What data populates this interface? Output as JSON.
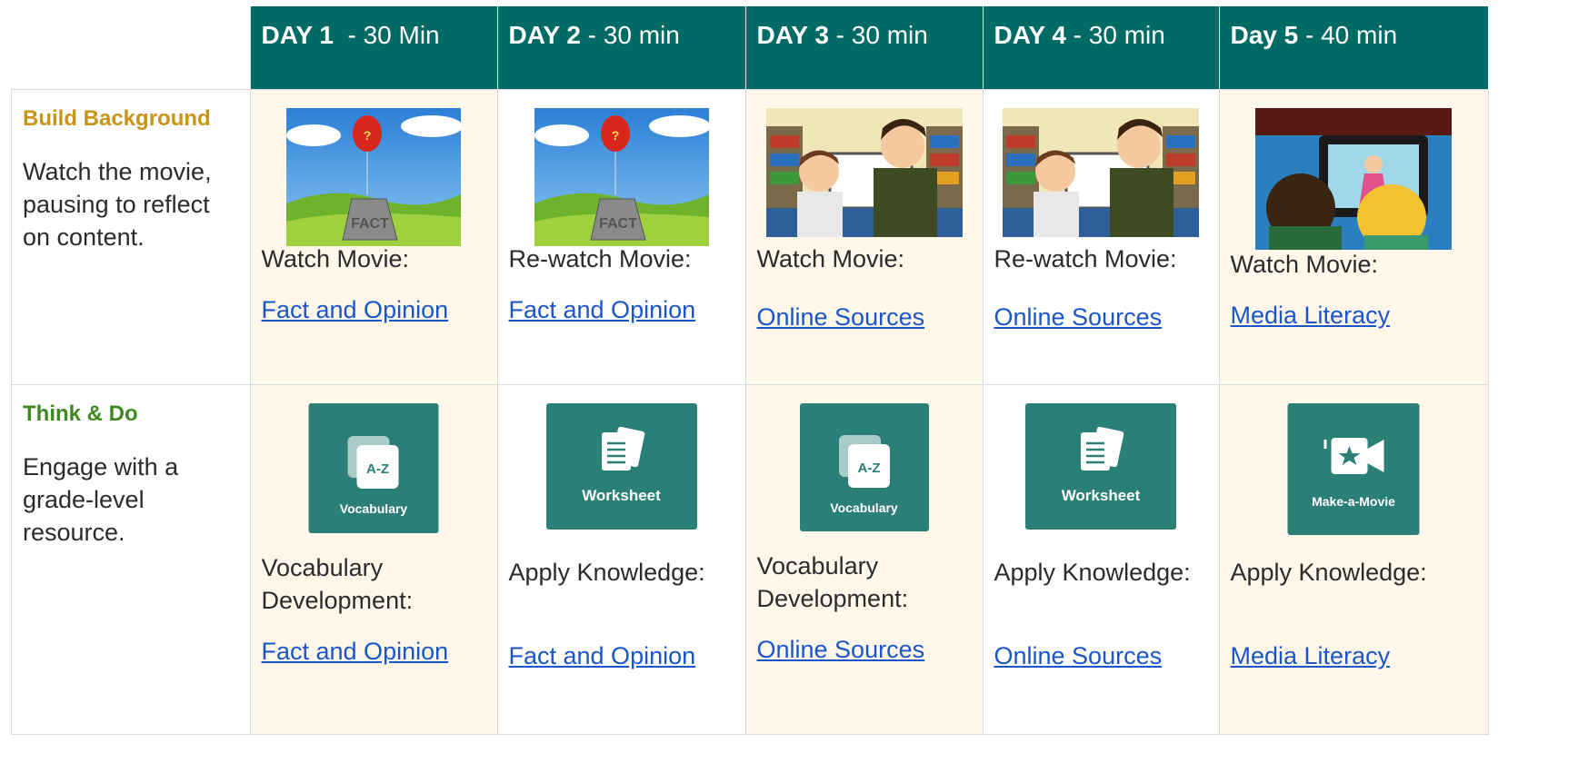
{
  "days": [
    {
      "label": "DAY 1",
      "duration": "  - 30 Min"
    },
    {
      "label": "DAY 2",
      "duration": " - 30 min"
    },
    {
      "label": "DAY 3",
      "duration": " - 30 min"
    },
    {
      "label": "DAY 4",
      "duration": " - 30 min"
    },
    {
      "label": "Day 5",
      "duration": " - 40 min"
    }
  ],
  "rows": {
    "build": {
      "title": "Build Background",
      "description": "Watch the movie, pausing to reflect on content.",
      "cells": [
        {
          "action": "Watch Movie:",
          "link": "Fact and Opinion",
          "thumb": "fact-opinion-balloon"
        },
        {
          "action": "Re-watch Movie:",
          "link": "Fact and Opinion",
          "thumb": "fact-opinion-balloon"
        },
        {
          "action": "Watch Movie:",
          "link": "Online Sources",
          "thumb": "library-computer"
        },
        {
          "action": "Re-watch Movie:",
          "link": "Online Sources",
          "thumb": "library-computer"
        },
        {
          "action": "Watch Movie:",
          "link": "Media Literacy",
          "thumb": "kids-watching-screen"
        }
      ]
    },
    "think": {
      "title": "Think & Do",
      "description": "Engage with a grade-level resource.",
      "cells": [
        {
          "resource": "Vocabulary",
          "action": "Vocabulary Development:",
          "link": "Fact and Opinion",
          "icon": "vocabulary-cards-icon",
          "badge": "A-Z"
        },
        {
          "resource": "Worksheet",
          "action": "Apply Knowledge:",
          "link": "Fact and Opinion",
          "icon": "worksheet-icon"
        },
        {
          "resource": "Vocabulary",
          "action": "Vocabulary Development:",
          "link": "Online Sources",
          "icon": "vocabulary-cards-icon",
          "badge": "A-Z"
        },
        {
          "resource": "Worksheet",
          "action": "Apply Knowledge:",
          "link": "Online Sources",
          "icon": "worksheet-icon"
        },
        {
          "resource": "Make-a-Movie",
          "action": "Apply Knowledge:",
          "link": "Media Literacy",
          "icon": "movie-camera-icon"
        }
      ]
    }
  },
  "colors": {
    "header_bg": "#006b64",
    "cream": "#fef7ea",
    "build_title": "#c8951a",
    "think_title": "#3e8a1f",
    "link": "#1a56c9",
    "resource_bg": "#2a8077"
  }
}
